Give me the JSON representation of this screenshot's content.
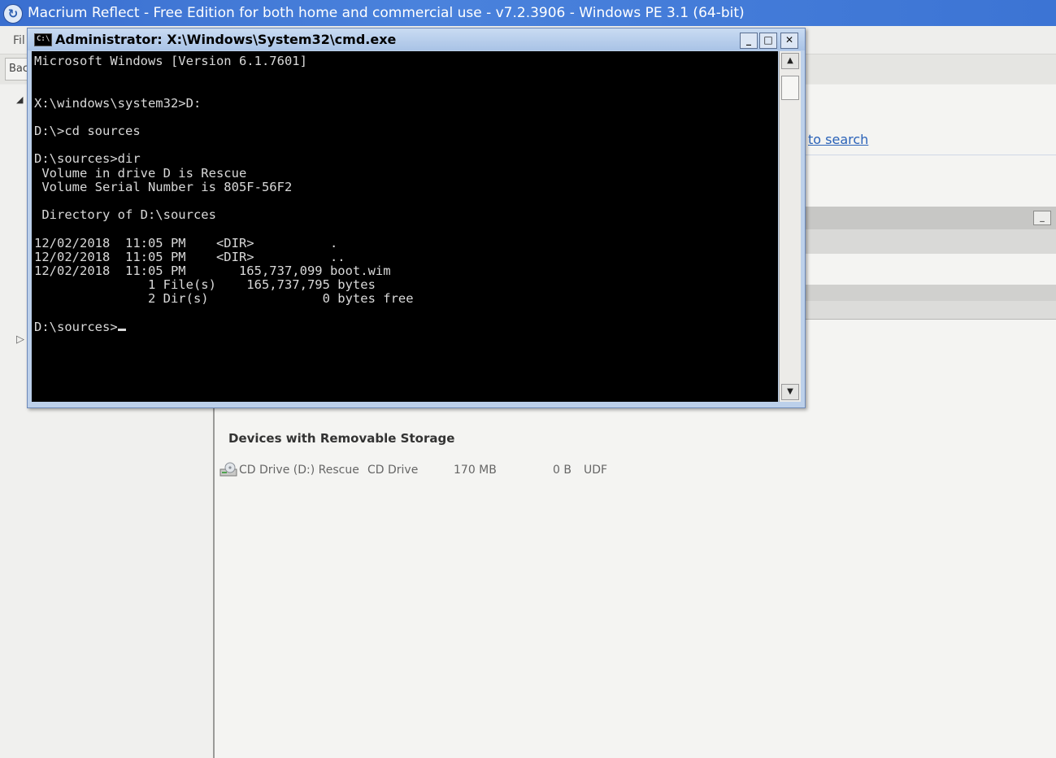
{
  "app": {
    "title": "Macrium Reflect - Free Edition for both home and commercial use - v7.2.3906 - Windows PE 3.1 (64-bit)",
    "menu_file": "Fil",
    "back_label": "Bac",
    "search_hint": "to search"
  },
  "storage": {
    "section_heading": "Devices with Removable Storage",
    "drive": {
      "name": "CD Drive (D:) Rescue",
      "type": "CD Drive",
      "size": "170 MB",
      "free": "0 B",
      "filesystem": "UDF"
    }
  },
  "cmd": {
    "title": "Administrator: X:\\Windows\\System32\\cmd.exe",
    "lines": [
      "Microsoft Windows [Version 6.1.7601]",
      "",
      "",
      "X:\\windows\\system32>D:",
      "",
      "D:\\>cd sources",
      "",
      "D:\\sources>dir",
      " Volume in drive D is Rescue",
      " Volume Serial Number is 805F-56F2",
      "",
      " Directory of D:\\sources",
      "",
      "12/02/2018  11:05 PM    <DIR>          .",
      "12/02/2018  11:05 PM    <DIR>          ..",
      "12/02/2018  11:05 PM       165,737,099 boot.wim",
      "               1 File(s)    165,737,795 bytes",
      "               2 Dir(s)               0 bytes free",
      ""
    ],
    "prompt": "D:\\sources>",
    "controls": {
      "minimize": "_",
      "maximize": "□",
      "close": "✕"
    }
  },
  "icons": {
    "app_logo": "macrium-logo-icon",
    "cmd": "cmd-icon",
    "drive": "cd-drive-icon"
  }
}
